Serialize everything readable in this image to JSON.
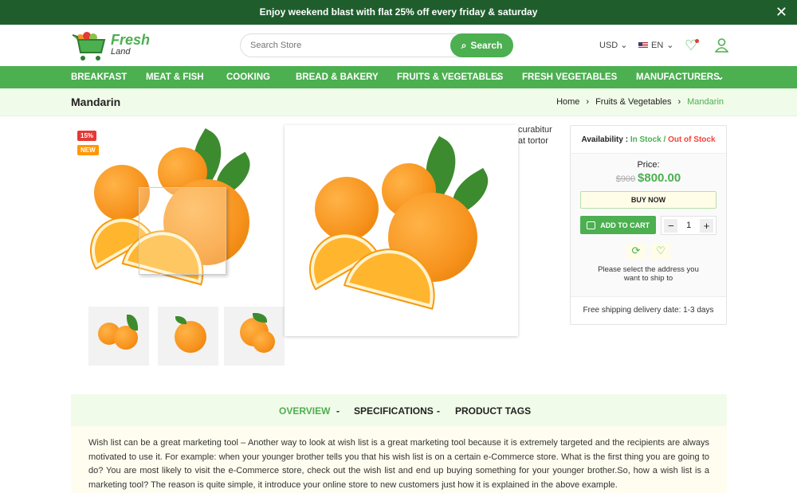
{
  "banner": {
    "text": "Enjoy weekend blast with flat 25% off every friday & saturday"
  },
  "header": {
    "logo_main": "Fresh",
    "logo_sub": "Land",
    "search_placeholder": "Search Store",
    "search_label": "Search",
    "currency": "USD",
    "language": "EN"
  },
  "nav": [
    "BREAKFAST",
    "MEAT & FISH",
    "COOKING",
    "BREAD & BAKERY",
    "FRUITS & VEGETABLES",
    "FRESH VEGETABLES",
    "MANUFACTURERS"
  ],
  "page": {
    "title": "Mandarin",
    "breadcrumb": [
      "Home",
      "Fruits & Vegetables",
      "Mandarin"
    ]
  },
  "product": {
    "badge_discount": "15%",
    "badge_new": "NEW",
    "behind_text_1": "curabitur",
    "behind_text_2": "at tortor"
  },
  "buybox": {
    "availability_label": "Availability :",
    "in_stock": "In Stock",
    "separator": "/",
    "out_of_stock": "Out of Stock",
    "price_label": "Price:",
    "old_price": "$900",
    "price": "$800.00",
    "buy_now": "BUY NOW",
    "add_to_cart": "ADD TO CART",
    "quantity": "1",
    "address_note": "Please select the address you want to ship to",
    "shipping": "Free shipping delivery date: 1-3 days"
  },
  "tabs": [
    "OVERVIEW",
    "SPECIFICATIONS",
    "PRODUCT TAGS"
  ],
  "tab_sep": "-",
  "description": "Wish list can be a great marketing tool – Another way to look at wish list is a great marketing tool because it is extremely targeted and the recipients are always motivated to use it. For example: when your younger brother tells you that his wish list is on a certain e-Commerce store. What is the first thing you are going to do? You are most likely to visit the e-Commerce store, check out the wish list and end up buying something for your younger brother.So, how a wish list is a marketing tool? The reason is quite simple, it introduce your online store to new customers just how it is explained in the above example.",
  "colors": {
    "brand": "#4caf50",
    "banner": "#1f5e2c",
    "out_of_stock": "#f44336",
    "light_green": "#f1fbe9"
  }
}
